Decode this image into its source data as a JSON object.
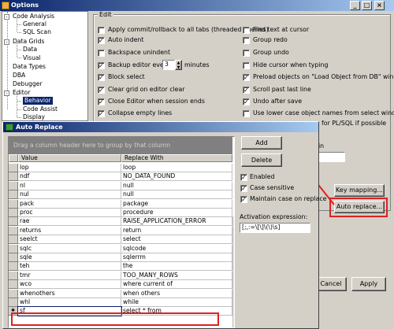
{
  "options_window": {
    "title": "Options",
    "tree": [
      {
        "label": "Code Analysis",
        "level": 0,
        "expander": "-"
      },
      {
        "label": "General",
        "level": 1
      },
      {
        "label": "SQL Scan",
        "level": 1
      },
      {
        "label": "Data Grids",
        "level": 0,
        "expander": "-"
      },
      {
        "label": "Data",
        "level": 1
      },
      {
        "label": "Visual",
        "level": 1
      },
      {
        "label": "Data Types",
        "level": 0
      },
      {
        "label": "DBA",
        "level": 0
      },
      {
        "label": "Debugger",
        "level": 0
      },
      {
        "label": "Editor",
        "level": 0,
        "expander": "-"
      },
      {
        "label": "Behavior",
        "level": 1,
        "selected": true
      },
      {
        "label": "Code Assist",
        "level": 1
      },
      {
        "label": "Display",
        "level": 1
      }
    ],
    "edit_group": {
      "legend": "Edit",
      "left_column": [
        {
          "label": "Apply commit/rollback to all tabs (threaded queries)",
          "checked": false
        },
        {
          "label": "Auto indent",
          "checked": true
        },
        {
          "label": "Backspace unindent",
          "checked": false
        },
        {
          "label": "Backup editor every",
          "checked": true
        },
        {
          "label": "Block select",
          "checked": true
        },
        {
          "label": "Clear grid on editor clear",
          "checked": true
        },
        {
          "label": "Close Editor when session ends",
          "checked": true
        },
        {
          "label": "Collapse empty lines",
          "checked": true
        }
      ],
      "backup_minutes": "3",
      "minutes_label": "minutes",
      "right_column": [
        {
          "label": "Find text at cursor",
          "checked": false
        },
        {
          "label": "Group redo",
          "checked": false
        },
        {
          "label": "Group undo",
          "checked": false
        },
        {
          "label": "Hide cursor when typing",
          "checked": false
        },
        {
          "label": "Preload objects on \"Load Object from DB\" window",
          "checked": true
        },
        {
          "label": "Scroll past last line",
          "checked": true
        },
        {
          "label": "Undo after save",
          "checked": true
        },
        {
          "label": "Use lower case object names from select windows",
          "checked": false
        }
      ],
      "partial_right_text": "for PL/SQL if possible",
      "partial_in": "in"
    },
    "key_mapping_button": "Key mapping...",
    "auto_replace_button": "Auto replace...",
    "cancel_button": "Cancel",
    "apply_button": "Apply"
  },
  "auto_replace_dialog": {
    "title": "Auto Replace",
    "group_hint": "Drag a column header here to group by that column",
    "columns": [
      "Value",
      "Replace With"
    ],
    "rows": [
      {
        "value": "lop",
        "replace": "loop"
      },
      {
        "value": "ndf",
        "replace": "NO_DATA_FOUND"
      },
      {
        "value": "nl",
        "replace": "null"
      },
      {
        "value": "nul",
        "replace": "null"
      },
      {
        "value": "pack",
        "replace": "package"
      },
      {
        "value": "proc",
        "replace": "procedure"
      },
      {
        "value": "rae",
        "replace": "RAISE_APPLICATION_ERROR"
      },
      {
        "value": "returns",
        "replace": "return"
      },
      {
        "value": "seelct",
        "replace": "select"
      },
      {
        "value": "sqlc",
        "replace": "sqlcode"
      },
      {
        "value": "sqle",
        "replace": "sqlerrm"
      },
      {
        "value": "teh",
        "replace": "the"
      },
      {
        "value": "tmr",
        "replace": "TOO_MANY_ROWS"
      },
      {
        "value": "wco",
        "replace": "where current of"
      },
      {
        "value": "whenothers",
        "replace": "when others"
      },
      {
        "value": "whl",
        "replace": "while"
      },
      {
        "value": "sf",
        "replace": "select * from",
        "editing": true
      }
    ],
    "add_button": "Add",
    "delete_button": "Delete",
    "enabled_label": "Enabled",
    "case_sensitive_label": "Case sensitive",
    "maintain_case_label": "Maintain case on replace",
    "activation_label": "Activation expression:",
    "activation_value": "[;,:=\\[\\]\\(\\)\\s]"
  },
  "colors": {
    "title_bar": "#0a246a",
    "annotation": "#e02020",
    "selection": "#0a246a"
  }
}
